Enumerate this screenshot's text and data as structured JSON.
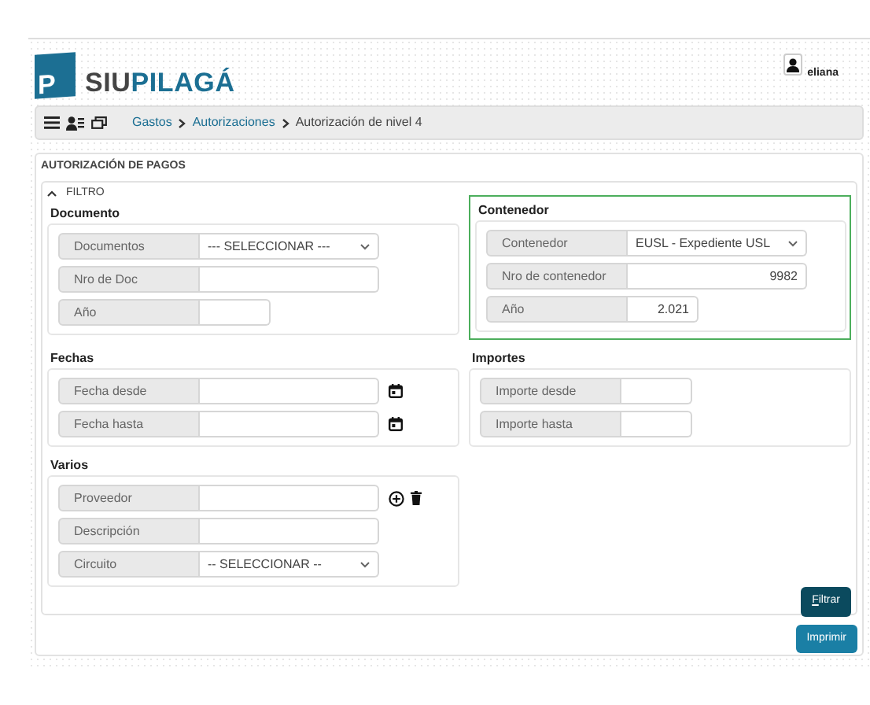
{
  "logo": {
    "mark": "P",
    "prefix": "SIU",
    "name": "PILAGÁ"
  },
  "user": {
    "name": "eliana"
  },
  "breadcrumb": [
    {
      "label": "Gastos",
      "link": true
    },
    {
      "label": "Autorizaciones",
      "link": true
    },
    {
      "label": "Autorización de nivel 4",
      "link": false
    }
  ],
  "panel": {
    "title": "AUTORIZACIÓN DE PAGOS"
  },
  "filter": {
    "title": "FILTRO",
    "expanded": true,
    "groups": [
      {
        "legend": "Documento",
        "highlighted": false,
        "fields": [
          {
            "label": "Documentos",
            "kind": "select",
            "value": "--- SELECCIONAR ---"
          },
          {
            "label": "Nro de Doc",
            "kind": "text"
          },
          {
            "label": "Año",
            "kind": "short"
          }
        ]
      },
      {
        "legend": "Contenedor",
        "highlighted": true,
        "fields": [
          {
            "label": "Contenedor",
            "kind": "select",
            "value": "EUSL - Expediente USL"
          },
          {
            "label": "Nro de contenedor",
            "kind": "text",
            "value": "9982"
          },
          {
            "label": "Año",
            "kind": "short",
            "value": "2.021"
          }
        ]
      },
      {
        "legend": "Fechas",
        "highlighted": false,
        "fields": [
          {
            "label": "Fecha desde",
            "kind": "date"
          },
          {
            "label": "Fecha hasta",
            "kind": "date"
          }
        ]
      },
      {
        "legend": "Importes",
        "highlighted": false,
        "fields": [
          {
            "label": "Importe desde",
            "kind": "short"
          },
          {
            "label": "Importe hasta",
            "kind": "short"
          }
        ]
      },
      {
        "legend": "Varios",
        "highlighted": false,
        "fields": [
          {
            "label": "Proveedor",
            "kind": "lookup"
          },
          {
            "label": "Descripción",
            "kind": "text"
          },
          {
            "label": "Circuito",
            "kind": "select",
            "value": "-- SELECCIONAR --"
          }
        ]
      }
    ],
    "button": "Filtrar"
  },
  "print_button": "Imprimir"
}
